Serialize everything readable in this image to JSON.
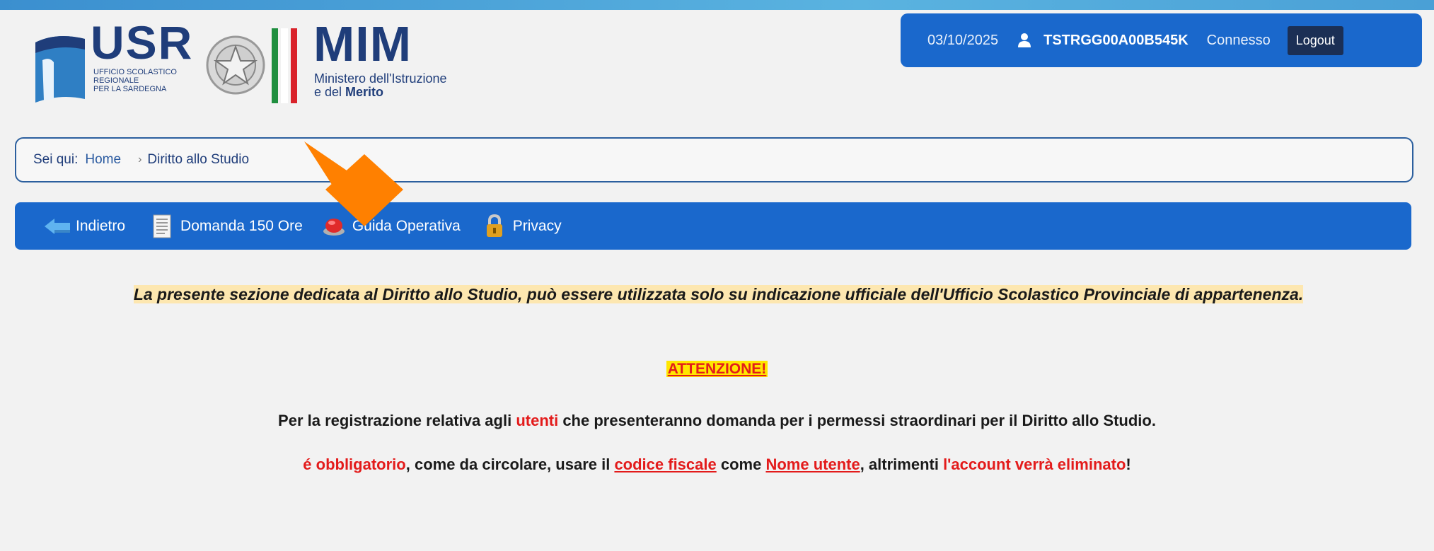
{
  "header": {
    "usr_logo_text": "USR",
    "usr_subtitle": [
      "Ufficio Scolastico",
      "Regionale",
      "per la Sardegna"
    ],
    "mim_logo_text": "MIM",
    "mim_subtitle_line1": "Ministero dell'Istruzione",
    "mim_subtitle_line2_prefix": "e del ",
    "mim_subtitle_line2_bold": "Merito",
    "flag_colors": [
      "#1f8f3f",
      "#ffffff",
      "#d9232b"
    ]
  },
  "userbox": {
    "date": "03/10/2025",
    "user_icon": "user-icon",
    "user_id": "TSTRGG00A00B545K",
    "status": "Connesso",
    "logout_label": "Logout"
  },
  "breadcrumb": {
    "label": "Sei qui:",
    "home": "Home",
    "separator": "›",
    "current": "Diritto allo Studio"
  },
  "toolbar": {
    "items": [
      {
        "label": "Indietro",
        "icon": "back-arrow-icon"
      },
      {
        "label": "Domanda 150 Ore",
        "icon": "document-icon"
      },
      {
        "label": "Guida Operativa",
        "icon": "help-button-icon"
      },
      {
        "label": "Privacy",
        "icon": "padlock-icon"
      }
    ]
  },
  "content": {
    "intro": "La presente sezione dedicata al Diritto allo Studio, può essere utilizzata solo su indicazione ufficiale dell'Ufficio Scolastico Provinciale di appartenenza.",
    "attention": "ATTENZIONE!",
    "p1": {
      "before": "Per la registrazione relativa agli ",
      "highlight": "utenti",
      "after": " che presenteranno domanda per i permessi straordinari per il Diritto allo Studio."
    },
    "p2": {
      "part1": "é obbligatorio",
      "part2": ", come da circolare, usare il ",
      "part3": "codice fiscale",
      "part4": " come ",
      "part5": "Nome utente",
      "part6": ", altrimenti ",
      "part7": "l'account verrà eliminato",
      "part8": "!"
    }
  },
  "colors": {
    "primary_blue": "#1a68cc",
    "dark_blue": "#1f3d7a",
    "alert_red": "#e31b1b",
    "highlight_yellow": "#ffe600",
    "annotation_orange": "#ff8000"
  }
}
